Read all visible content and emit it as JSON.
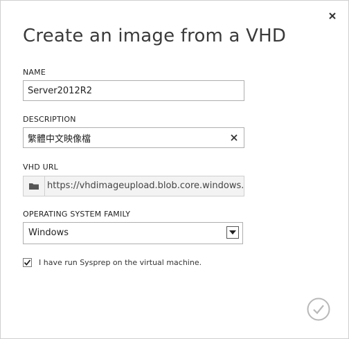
{
  "dialog": {
    "title": "Create an image from a VHD"
  },
  "fields": {
    "name": {
      "label": "NAME",
      "value": "Server2012R2"
    },
    "description": {
      "label": "DESCRIPTION",
      "value": "繁體中文映像檔"
    },
    "vhd_url": {
      "label": "VHD URL",
      "value": "https://vhdimageupload.blob.core.windows.net/v"
    },
    "os_family": {
      "label": "OPERATING SYSTEM FAMILY",
      "selected": "Windows"
    }
  },
  "sysprep": {
    "checked": true,
    "label": "I have run Sysprep on the virtual machine."
  },
  "icons": {
    "close": "close-icon",
    "clear": "clear-icon",
    "folder": "folder-icon",
    "dropdown": "chevron-down-icon",
    "checkmark": "checkmark-icon",
    "confirm": "confirm-check-icon"
  },
  "colors": {
    "border": "#aeaeae",
    "readonly_bg": "#f3f3f3",
    "confirm_circle": "#b8b8b8",
    "text": "#222222"
  }
}
